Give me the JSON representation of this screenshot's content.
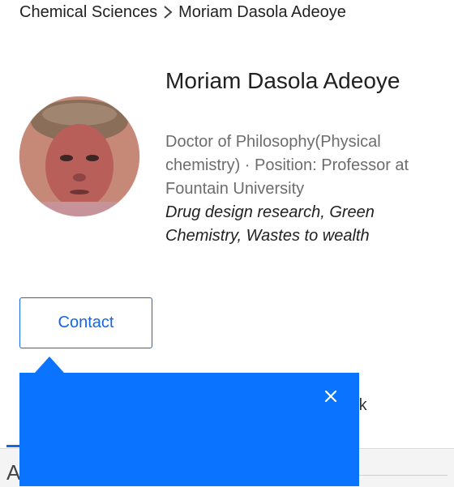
{
  "breadcrumb": {
    "parent": "Chemical Sciences",
    "separator_icon": "chevron-right-icon",
    "current": "Moriam Dasola Adeoye"
  },
  "profile": {
    "name": "Moriam Dasola Adeoye",
    "degree_position": "Doctor of Philosophy(Physical chemistry) · Position: Professor at Fountain University",
    "interests": "Drug design research, Green Chemistry, Wastes to wealth"
  },
  "actions": {
    "contact_label": "Contact"
  },
  "background": {
    "tab_fragment": "rk",
    "section_letter": "A"
  },
  "popover": {
    "close_icon": "close-icon"
  },
  "colors": {
    "accent": "#1565e8",
    "popover": "#0a73ff"
  }
}
